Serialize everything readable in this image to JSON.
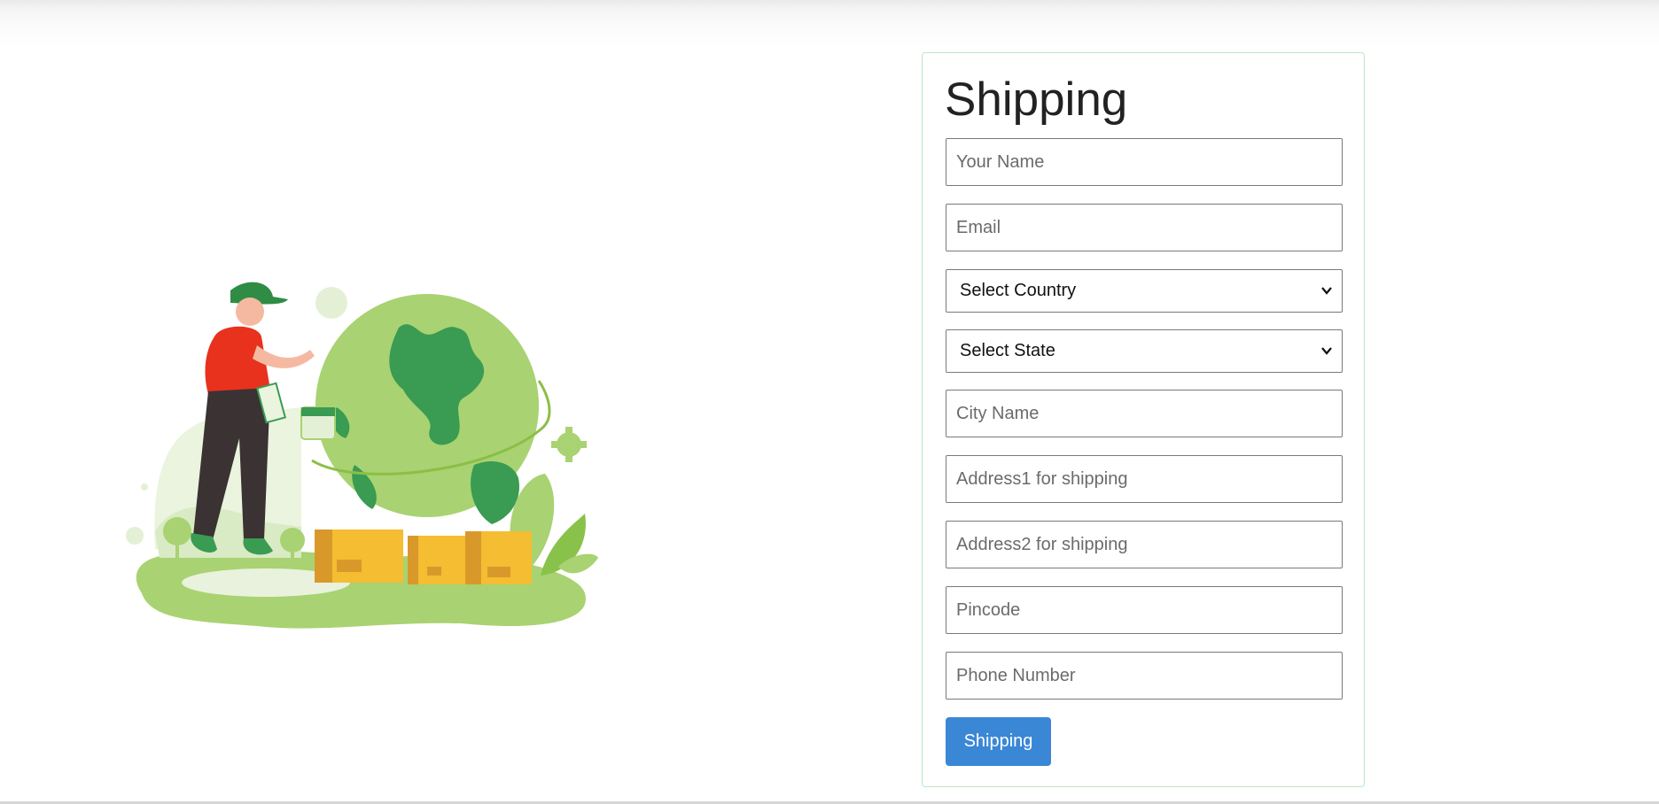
{
  "form": {
    "title": "Shipping",
    "fields": {
      "name_placeholder": "Your Name",
      "email_placeholder": "Email",
      "country_selected": "Select Country",
      "state_selected": "Select State",
      "city_placeholder": "City Name",
      "address1_placeholder": "Address1 for shipping",
      "address2_placeholder": "Address2 for shipping",
      "pincode_placeholder": "Pincode",
      "phone_placeholder": "Phone Number"
    },
    "submit_label": "Shipping"
  },
  "illustration": {
    "icon": "delivery-man-globe-illustration"
  },
  "colors": {
    "accent": "#3a87d6",
    "card_border": "#b9e8c6",
    "globe": "#a9d272",
    "continents": "#3a9b52",
    "box": "#f4bd32",
    "shirt": "#e8321e"
  }
}
